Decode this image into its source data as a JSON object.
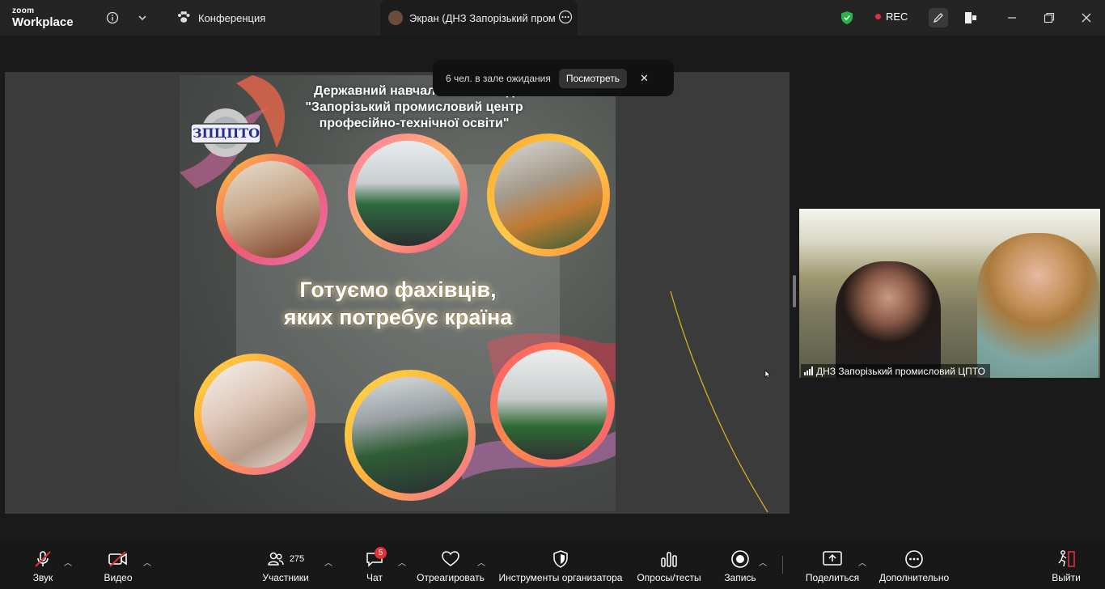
{
  "app": {
    "logo_top": "zoom",
    "logo_bottom": "Workplace"
  },
  "tabs": [
    {
      "label": "Конференция"
    },
    {
      "label": "Экран (ДНЗ Запорізький проми"
    }
  ],
  "status": {
    "rec_label": "REC"
  },
  "notification": {
    "text": "6 чел. в зале ожидания",
    "button": "Посмотреть"
  },
  "slide": {
    "title_lines": [
      "Державний навчальний заклад",
      "\"Запорізький промисловий центр",
      "професійно-технічної освіти\""
    ],
    "emblem": "ЗПЦПТО",
    "slogan_lines": [
      "Готуємо фахівців,",
      "яких потребує країна"
    ]
  },
  "participant": {
    "name": "ДНЗ Запорізький промисловий ЦПТО"
  },
  "toolbar": {
    "audio": "Звук",
    "video": "Видео",
    "participants": "Участники",
    "participants_count": "275",
    "chat": "Чат",
    "chat_badge": "5",
    "react": "Отреагировать",
    "host_tools": "Инструменты организатора",
    "polls": "Опросы/тесты",
    "record": "Запись",
    "share": "Поделиться",
    "more": "Дополнительно",
    "leave": "Выйти"
  },
  "colors": {
    "leave": "#e0303a",
    "shield": "#27b44d",
    "rec_dot": "#e0303a",
    "annotation_line": "#d6b020"
  }
}
